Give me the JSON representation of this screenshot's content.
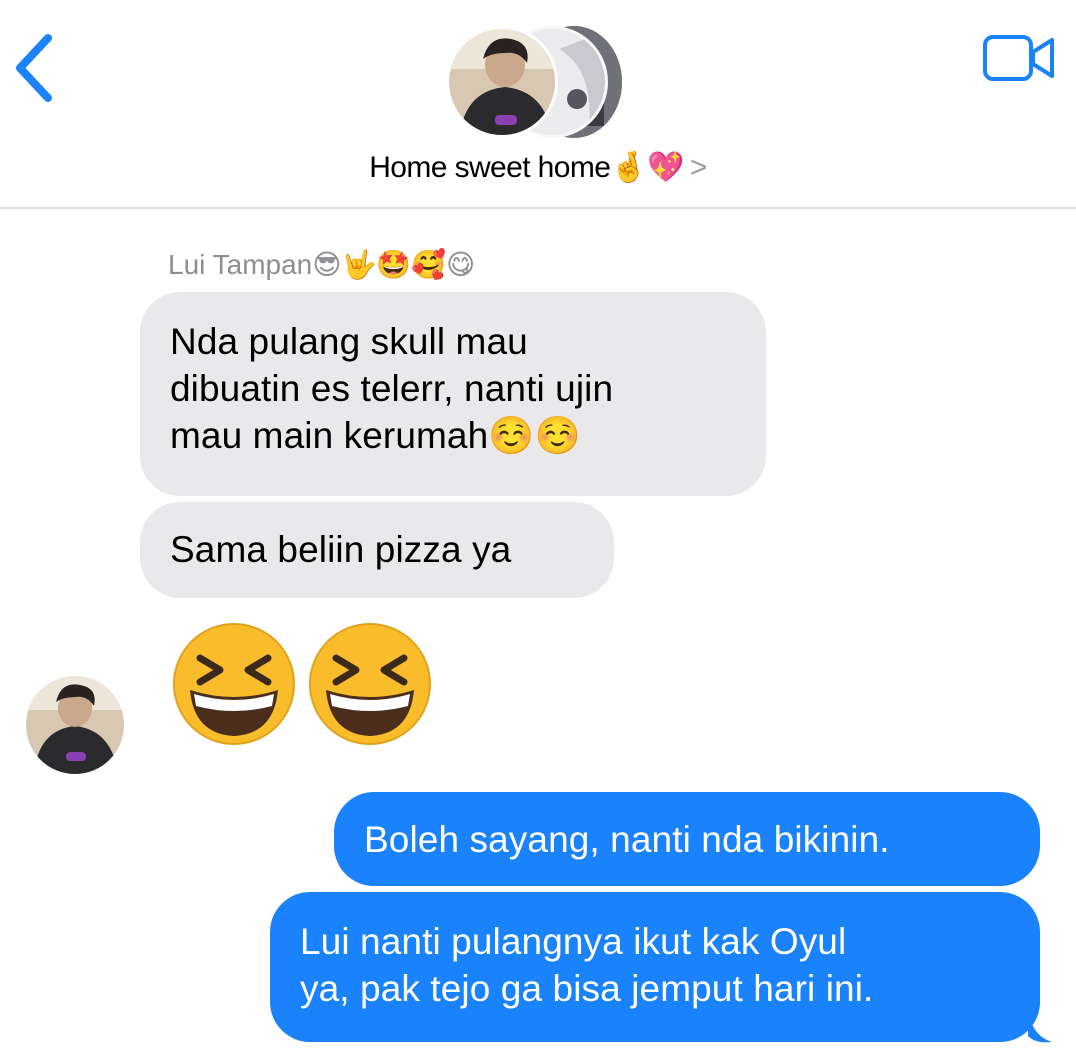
{
  "header": {
    "group_name": "Home sweet home",
    "group_name_emojis": "🤞💖",
    "chevron": ">",
    "back_icon": "chevron-left-icon",
    "video_icon": "video-camera-icon",
    "accent_color": "#1a82fb"
  },
  "messages": [
    {
      "direction": "incoming",
      "sender": "Lui Tampan😎🤟🤩🥰😋",
      "lines": [
        "Nda pulang skull mau",
        "dibuatin es telerr, nanti ujin",
        "mau main kerumah☺️☺️"
      ]
    },
    {
      "direction": "incoming",
      "lines": [
        "Sama beliin pizza ya"
      ]
    },
    {
      "direction": "incoming",
      "type": "emoji-only",
      "content": "😆😆"
    },
    {
      "direction": "outgoing",
      "lines": [
        "Boleh sayang, nanti nda bikinin."
      ]
    },
    {
      "direction": "outgoing",
      "lines": [
        "Lui nanti pulangnya ikut kak Oyul",
        "ya, pak tejo ga bisa jemput hari ini."
      ]
    }
  ],
  "colors": {
    "incoming_bubble": "#e9e9eb",
    "outgoing_bubble": "#1a82fb",
    "sender_name": "#8e8e93"
  }
}
